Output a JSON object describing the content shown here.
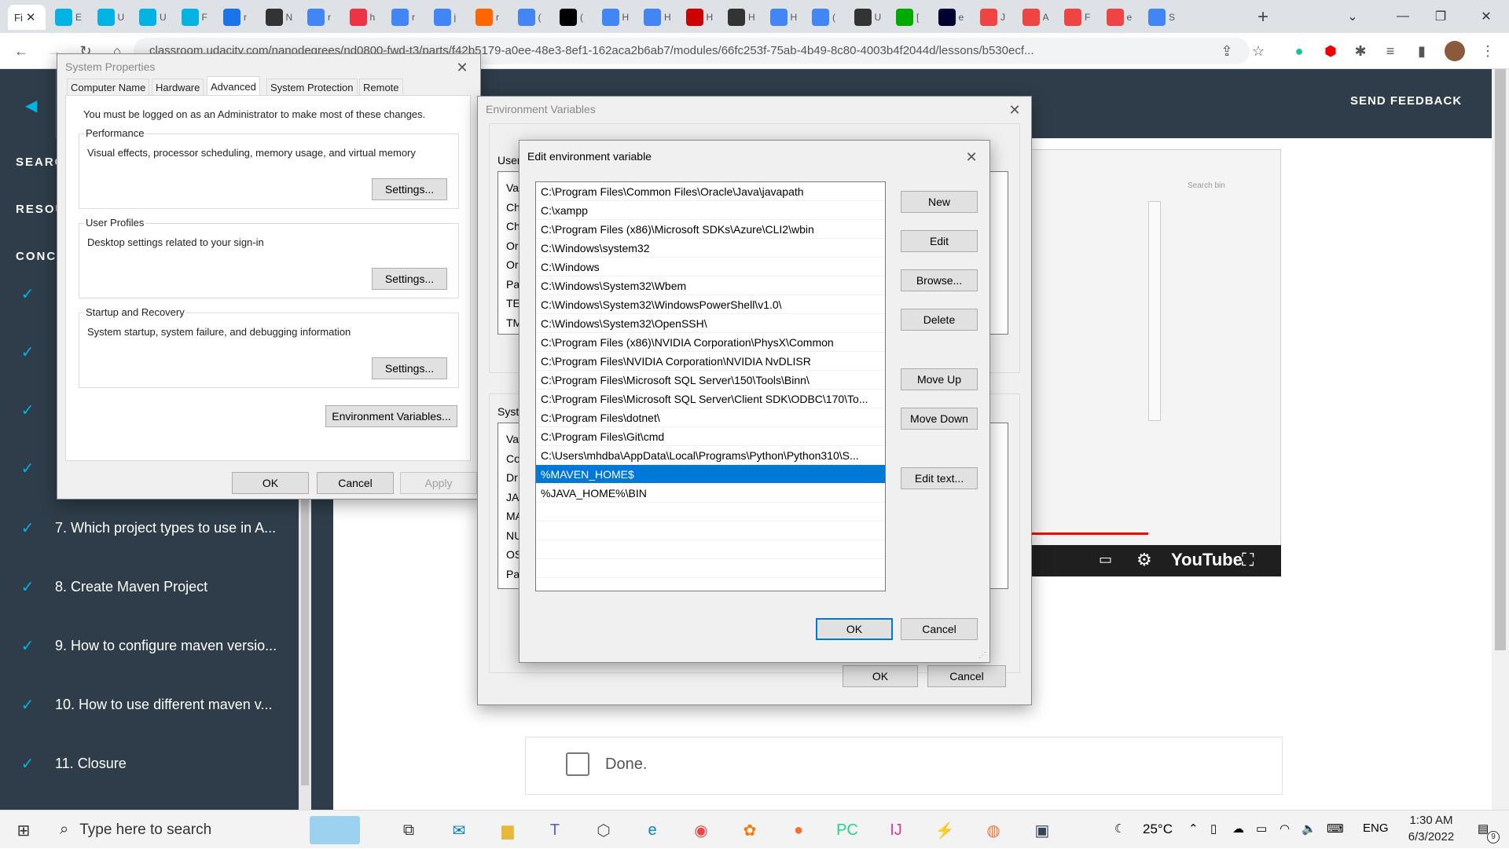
{
  "browser": {
    "tab_labels": [
      "Fi",
      "E",
      "U",
      "U",
      "F",
      "r",
      "N",
      "r",
      "h",
      "r",
      "j",
      "r",
      "(",
      "(",
      "H",
      "H",
      "H",
      "H",
      "H",
      "(",
      "U",
      "[",
      "e",
      "J",
      "A",
      "F",
      "e",
      "S"
    ],
    "url": "classroom.udacity.com/nanodegrees/nd0800-fwd-t3/parts/f42b5179-a0ee-48e3-8ef1-162aca2b6ab7/modules/66fc253f-75ab-4b49-8c80-4003b4f2044d/lessons/b530ecf...",
    "new_tab": "+"
  },
  "page": {
    "feedback": "SEND FEEDBACK",
    "side_headers": [
      "SEARC",
      "RESOU",
      "CONC"
    ],
    "lessons": [
      "7. Which project types to use in A...",
      "8. Create Maven Project",
      "9. How to configure maven versio...",
      "10. How to use different maven v...",
      "11. Closure"
    ],
    "done_label": "Done.",
    "youtube": "YouTube",
    "video_search": "Search bin"
  },
  "system_properties": {
    "title": "System Properties",
    "tabs": [
      "Computer Name",
      "Hardware",
      "Advanced",
      "System Protection",
      "Remote"
    ],
    "admin_note": "You must be logged on as an Administrator to make most of these changes.",
    "perf_title": "Performance",
    "perf_desc": "Visual effects, processor scheduling, memory usage, and virtual memory",
    "profiles_title": "User Profiles",
    "profiles_desc": "Desktop settings related to your sign-in",
    "startup_title": "Startup and Recovery",
    "startup_desc": "System startup, system failure, and debugging information",
    "settings_btn": "Settings...",
    "env_btn": "Environment Variables...",
    "ok": "OK",
    "cancel": "Cancel",
    "apply": "Apply"
  },
  "env_vars": {
    "title": "Environment Variables",
    "user_frag": "User",
    "sys_frag": "Syste",
    "user_rows": [
      "Va",
      "Ch",
      "Ch",
      "Or",
      "Or",
      "Pa",
      "TE",
      "TM"
    ],
    "sys_rows": [
      "Va",
      "Co",
      "Dr",
      "JA",
      "MA",
      "NU",
      "OS",
      "Pa"
    ],
    "ok": "OK",
    "cancel": "Cancel"
  },
  "edit_var": {
    "title": "Edit environment variable",
    "paths": [
      "C:\\Program Files\\Common Files\\Oracle\\Java\\javapath",
      "C:\\xampp",
      "C:\\Program Files (x86)\\Microsoft SDKs\\Azure\\CLI2\\wbin",
      "C:\\Windows\\system32",
      "C:\\Windows",
      "C:\\Windows\\System32\\Wbem",
      "C:\\Windows\\System32\\WindowsPowerShell\\v1.0\\",
      "C:\\Windows\\System32\\OpenSSH\\",
      "C:\\Program Files (x86)\\NVIDIA Corporation\\PhysX\\Common",
      "C:\\Program Files\\NVIDIA Corporation\\NVIDIA NvDLISR",
      "C:\\Program Files\\Microsoft SQL Server\\150\\Tools\\Binn\\",
      "C:\\Program Files\\Microsoft SQL Server\\Client SDK\\ODBC\\170\\To...",
      "C:\\Program Files\\dotnet\\",
      "C:\\Program Files\\Git\\cmd",
      "C:\\Users\\mhdba\\AppData\\Local\\Programs\\Python\\Python310\\S...",
      "%MAVEN_HOME$",
      "%JAVA_HOME%\\BIN"
    ],
    "selected_index": 15,
    "buttons": {
      "new": "New",
      "edit": "Edit",
      "browse": "Browse...",
      "delete": "Delete",
      "move_up": "Move Up",
      "move_down": "Move Down",
      "edit_text": "Edit text..."
    },
    "ok": "OK",
    "cancel": "Cancel"
  },
  "taskbar": {
    "search_placeholder": "Type here to search",
    "weather": "25°C",
    "lang": "ENG",
    "time": "1:30 AM",
    "date": "6/3/2022",
    "notif_count": "9"
  }
}
